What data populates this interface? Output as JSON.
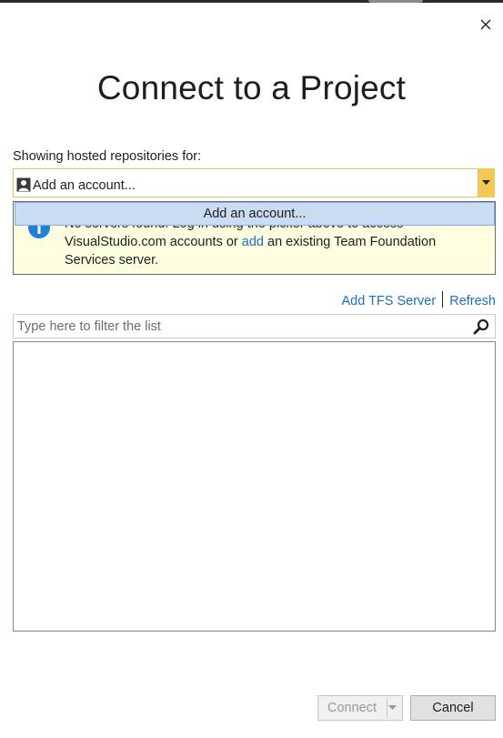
{
  "dialog": {
    "title": "Connect to a Project"
  },
  "account": {
    "label": "Showing hosted repositories for:",
    "selected": "Add an account...",
    "dropdown_options": [
      "Add an account..."
    ]
  },
  "info": {
    "text_line1_start": "No servers found. Log in using the picker above to access",
    "text_line2_start": "VisualStudio.com accounts or ",
    "link": "add",
    "text_line2_end": " an existing Team Foundation",
    "text_line3": "Services server."
  },
  "links": {
    "add_tfs_server": "Add TFS Server",
    "refresh": "Refresh"
  },
  "filter": {
    "placeholder": "Type here to filter the list",
    "value": ""
  },
  "footer": {
    "connect_label": "Connect",
    "cancel_label": "Cancel"
  },
  "colors": {
    "accent_link": "#1e6fbf",
    "combo_border": "#e5c365",
    "combo_arrow_bg": "#f2c955",
    "info_bg": "#fefee0",
    "dropdown_highlight": "#c9dcf2",
    "info_icon": "#1e80d6"
  },
  "icons": {
    "close": "close-icon",
    "account": "user-icon",
    "dropdown": "chevron-down-icon",
    "info": "info-icon",
    "search": "search-icon"
  }
}
